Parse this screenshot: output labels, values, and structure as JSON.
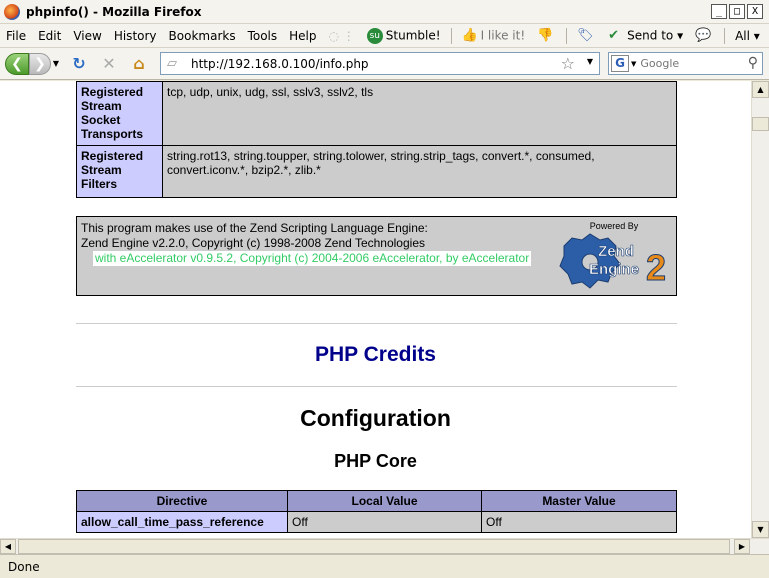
{
  "window": {
    "title": "phpinfo() - Mozilla Firefox",
    "controls": [
      "_",
      "□",
      "X"
    ]
  },
  "menu": {
    "items": [
      "File",
      "Edit",
      "View",
      "History",
      "Bookmarks",
      "Tools",
      "Help"
    ],
    "toolbar": {
      "stumble": "Stumble!",
      "like": "I like it!",
      "send_to": "Send to",
      "all": "All"
    }
  },
  "nav": {
    "url": "http://192.168.0.100/info.php",
    "search_placeholder": "Google"
  },
  "phpinfo": {
    "rows": [
      {
        "key": "Registered Stream Socket Transports",
        "value": "tcp, udp, unix, udg, ssl, sslv3, sslv2, tls"
      },
      {
        "key": "Registered Stream Filters",
        "value": "string.rot13, string.toupper, string.tolower, string.strip_tags, convert.*, consumed, convert.iconv.*, bzip2.*, zlib.*"
      }
    ],
    "zend": {
      "line1": "This program makes use of the Zend Scripting Language Engine:",
      "line2": "Zend Engine v2.2.0, Copyright (c) 1998-2008 Zend Technologies",
      "line3": "with eAccelerator v0.9.5.2, Copyright (c) 2004-2006 eAccelerator, by eAccelerator",
      "powered_by": "Powered By",
      "logo_text_1": "Zend",
      "logo_text_2": "Engine",
      "logo_number": "2"
    },
    "credits_link": "PHP Credits",
    "config_heading": "Configuration",
    "core_heading": "PHP Core",
    "core_table": {
      "headers": [
        "Directive",
        "Local Value",
        "Master Value"
      ],
      "rows": [
        {
          "directive": "allow_call_time_pass_reference",
          "local": "Off",
          "master": "Off"
        }
      ]
    }
  },
  "status": {
    "text": "Done"
  }
}
